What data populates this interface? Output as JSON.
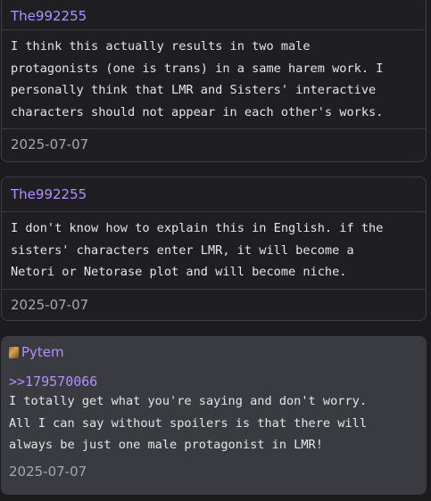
{
  "comments": [
    {
      "author": "The992255",
      "text": "I think this actually results in two male protagonists (one is trans) in a same harem work. I personally think that LMR and Sisters' interactive characters should not appear in each other's works.",
      "date": "2025-07-07"
    },
    {
      "author": "The992255",
      "text": "I don't know how to explain this in English. if the sisters' characters enter LMR, it will become a Netori or Netorase plot and will become niche.",
      "date": "2025-07-07"
    },
    {
      "author": "Pytem",
      "reply_to": ">>179570066",
      "text": "I totally get what you're saying and don't worry. All I can say without spoilers is that there will always be just one male protagonist in LMR!",
      "date": "2025-07-07"
    }
  ]
}
